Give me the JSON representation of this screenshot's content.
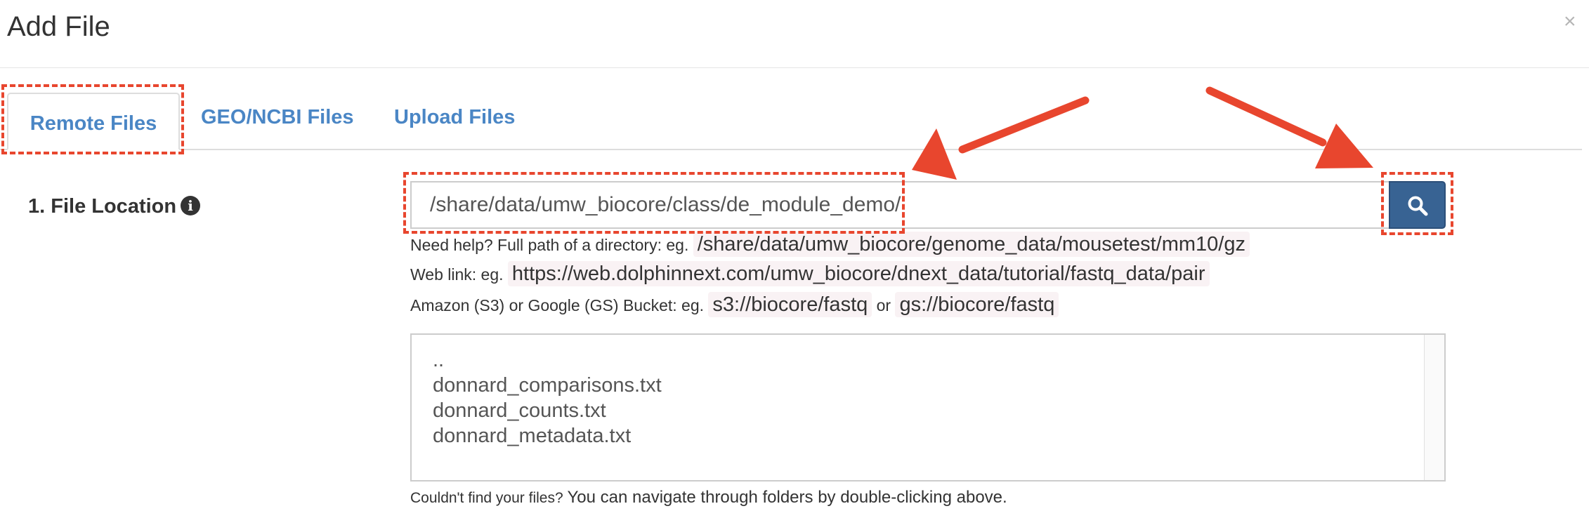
{
  "dialog": {
    "title": "Add File",
    "close_symbol": "×"
  },
  "tabs": [
    {
      "label": "Remote Files",
      "active": true
    },
    {
      "label": "GEO/NCBI Files",
      "active": false
    },
    {
      "label": "Upload Files",
      "active": false
    }
  ],
  "file_location": {
    "label": "1. File Location",
    "info_symbol": "i",
    "value": "/share/data/umw_biocore/class/de_module_demo/",
    "search_icon": "search-icon"
  },
  "help": {
    "line1_prefix": "Need help? Full path of a directory: eg.",
    "line1_example": "/share/data/umw_biocore/genome_data/mousetest/mm10/gz",
    "line2_prefix": "Web link: eg.",
    "line2_example": "https://web.dolphinnext.com/umw_biocore/dnext_data/tutorial/fastq_data/pair",
    "line3_prefix": "Amazon (S3) or Google (GS) Bucket: eg.",
    "line3_example1": "s3://biocore/fastq",
    "line3_or": "or",
    "line3_example2": "gs://biocore/fastq"
  },
  "file_list": {
    "items": [
      "..",
      "donnard_comparisons.txt",
      "donnard_counts.txt",
      "donnard_metadata.txt"
    ]
  },
  "footnote": {
    "prefix": "Couldn't find your files?",
    "text": "You can navigate through folders by double-clicking above."
  },
  "annotation_color": "#e8462e",
  "accent_color": "#386393",
  "link_color": "#4a86c5"
}
